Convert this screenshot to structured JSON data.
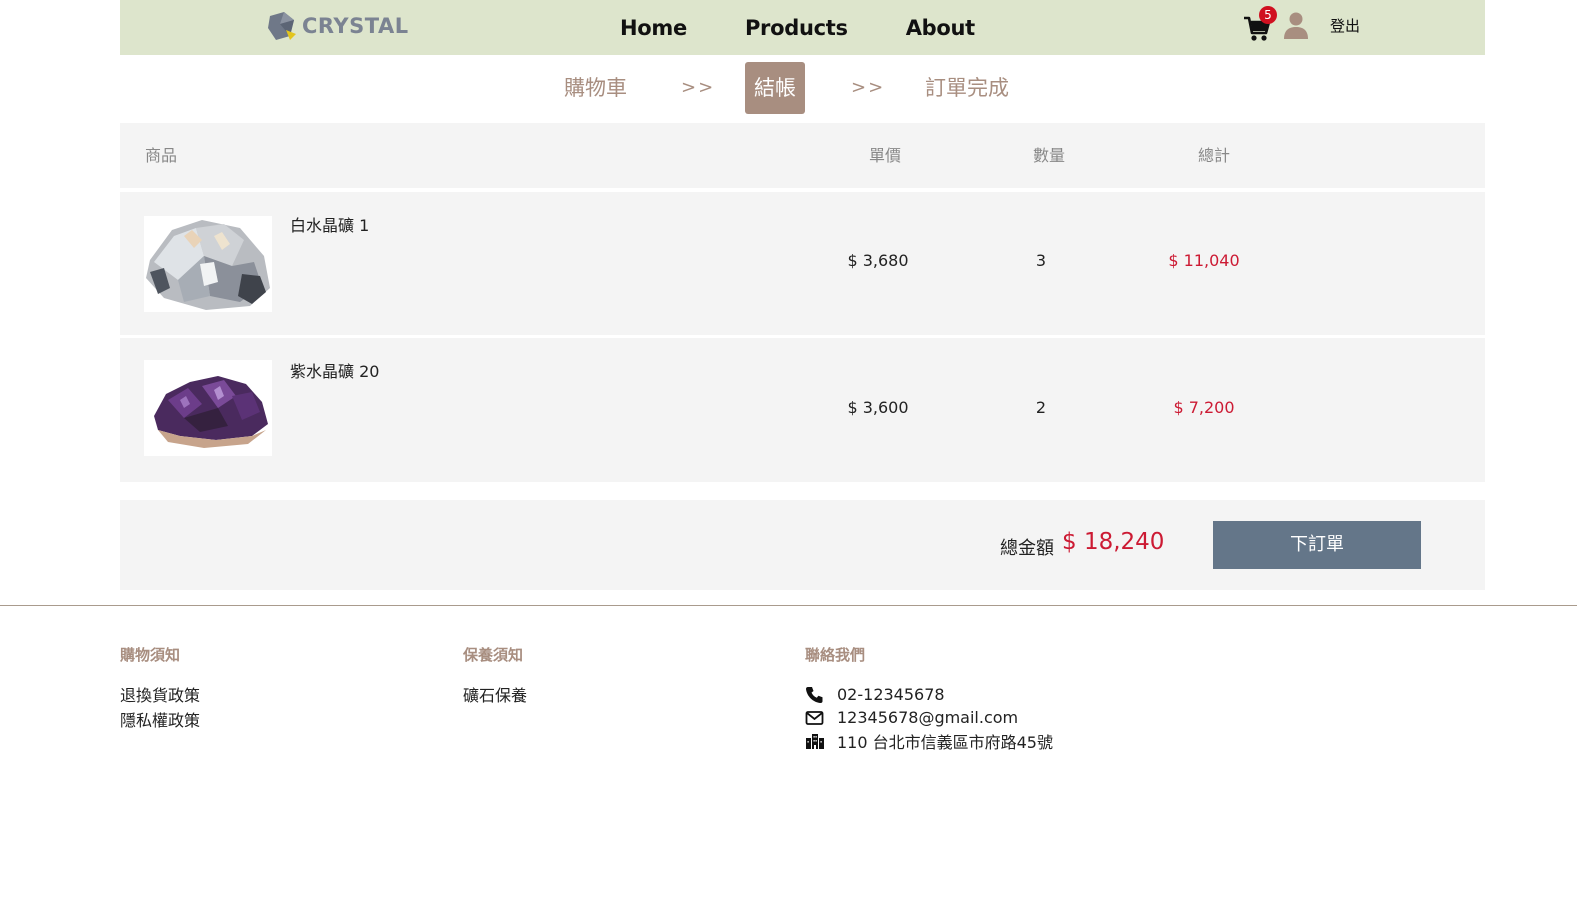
{
  "header": {
    "logo_text": "CRYSTAL",
    "nav": [
      "Home",
      "Products",
      "About"
    ],
    "cart_count": "5",
    "logout_label": "登出"
  },
  "steps": {
    "cart": "購物車",
    "arrow": ">>",
    "checkout": "結帳",
    "complete": "訂單完成"
  },
  "table": {
    "headers": {
      "product": "商品",
      "unit_price": "單價",
      "quantity": "數量",
      "subtotal": "總計"
    },
    "rows": [
      {
        "name": "白水晶礦 1",
        "price": "$ 3,680",
        "qty": "3",
        "subtotal": "$ 11,040"
      },
      {
        "name": "紫水晶礦 20",
        "price": "$ 3,600",
        "qty": "2",
        "subtotal": "$ 7,200"
      }
    ]
  },
  "summary": {
    "total_label": "總金額",
    "total_value": "$ 18,240",
    "order_button": "下訂單"
  },
  "footer": {
    "shopping": {
      "title": "購物須知",
      "links": [
        "退換貨政策",
        "隱私權政策"
      ]
    },
    "care": {
      "title": "保養須知",
      "links": [
        "礦石保養"
      ]
    },
    "contact": {
      "title": "聯絡我們",
      "phone": "02-12345678",
      "email": "12345678@gmail.com",
      "address": "110 台北市信義區市府路45號"
    }
  },
  "colors": {
    "header_bg": "#dde5cc",
    "accent": "#a88e80",
    "price_red": "#cc1a33",
    "button": "#647689"
  }
}
